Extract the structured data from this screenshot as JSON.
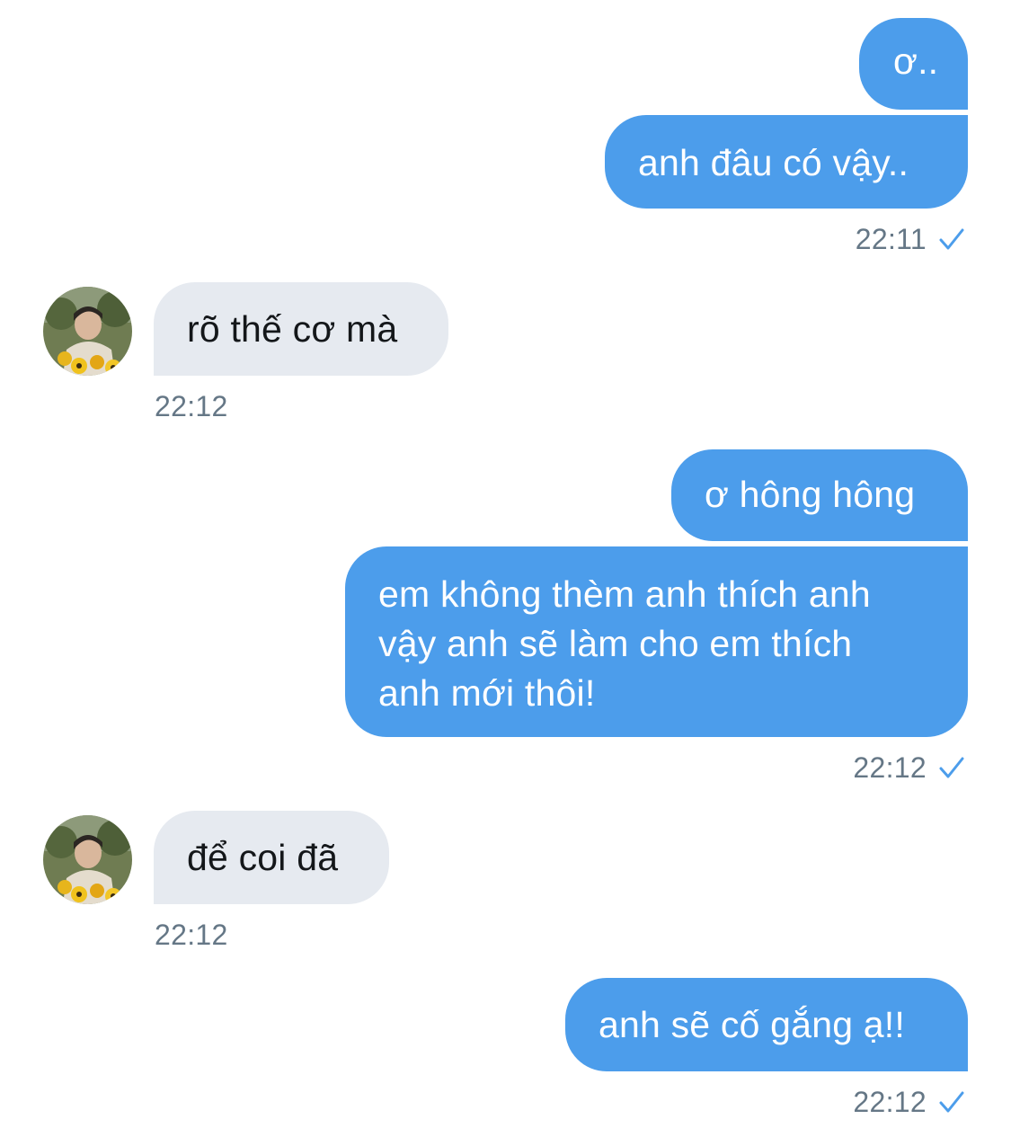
{
  "colors": {
    "sent_bubble": "#4c9deb",
    "received_bubble": "#e6eaf0",
    "timestamp": "#657786",
    "read_check": "#4c9deb"
  },
  "messages": [
    {
      "id": "m1",
      "direction": "sent",
      "text": "ơ.."
    },
    {
      "id": "m2",
      "direction": "sent",
      "text": "anh đâu có vậy.."
    },
    {
      "id": "m3",
      "direction": "received",
      "text": "rõ thế cơ mà"
    },
    {
      "id": "m4",
      "direction": "sent",
      "text": "ơ hông hông"
    },
    {
      "id": "m5",
      "direction": "sent",
      "lines": [
        "em không thèm anh thích anh",
        "vậy anh sẽ làm cho em thích",
        "anh mới thôi!"
      ]
    },
    {
      "id": "m6",
      "direction": "received",
      "text": "để coi đã"
    },
    {
      "id": "m7",
      "direction": "sent",
      "text": "anh sẽ cố gắng ạ!!"
    }
  ],
  "timestamps": {
    "t1": "22:11",
    "t2": "22:12",
    "t3": "22:12",
    "t4": "22:12",
    "t5": "22:12"
  },
  "icons": {
    "read_check": "checkmark-icon",
    "avatar": "avatar"
  }
}
